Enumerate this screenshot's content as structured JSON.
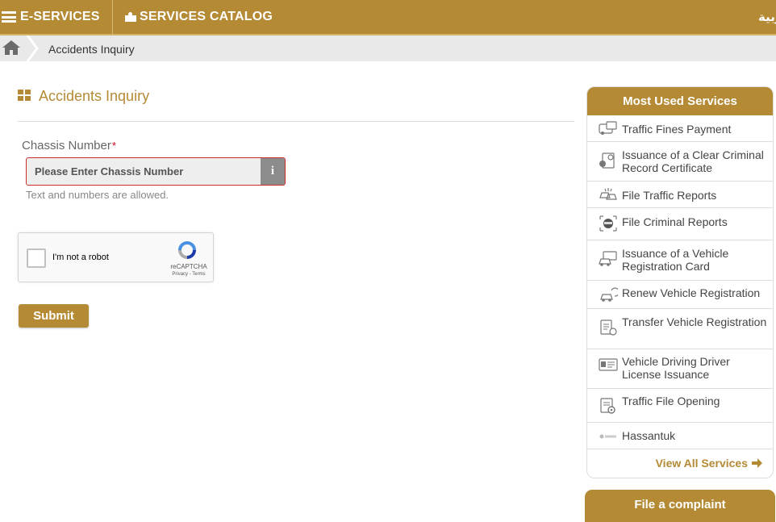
{
  "topbar": {
    "eservices_label": "E-SERVICES",
    "catalog_label": "SERVICES CATALOG",
    "language_label": "عربية"
  },
  "breadcrumb": {
    "current": "Accidents Inquiry"
  },
  "page": {
    "title": "Accidents Inquiry"
  },
  "form": {
    "chassis_label": "Chassis Number",
    "required_mark": "*",
    "chassis_placeholder": "Please Enter Chassis Number",
    "chassis_value": "",
    "info_glyph": "i",
    "helper_text": "Text and numbers are allowed.",
    "submit_label": "Submit"
  },
  "recaptcha": {
    "label": "I'm not a robot",
    "brand": "reCAPTCHA",
    "terms": "Privacy - Terms",
    "checked": false
  },
  "sidebar": {
    "title": "Most Used Services",
    "items": [
      {
        "label": "Traffic Fines Payment",
        "icon": "car-fine-icon"
      },
      {
        "label": "Issuance of a Clear Criminal Record Certificate",
        "icon": "certificate-icon"
      },
      {
        "label": "File Traffic Reports",
        "icon": "car-crash-icon"
      },
      {
        "label": "File Criminal Reports",
        "icon": "masked-person-icon"
      },
      {
        "label": "Issuance of a Vehicle Registration Card",
        "icon": "vehicle-card-icon"
      },
      {
        "label": "Renew Vehicle Registration",
        "icon": "renew-vehicle-icon"
      },
      {
        "label": "Transfer Vehicle Registration",
        "icon": "transfer-document-icon"
      },
      {
        "label": "Vehicle Driving Driver License Issuance",
        "icon": "license-card-icon"
      },
      {
        "label": "Traffic File Opening",
        "icon": "traffic-file-icon"
      },
      {
        "label": "Hassantuk",
        "icon": "hassantuk-logo-icon"
      }
    ],
    "view_all_label": "View All Services"
  },
  "complaint": {
    "label": "File a complaint"
  },
  "colors": {
    "brand_gold": "#b48a35",
    "error_red": "#c9302c",
    "breadcrumb_bg": "#e9e9e9"
  }
}
